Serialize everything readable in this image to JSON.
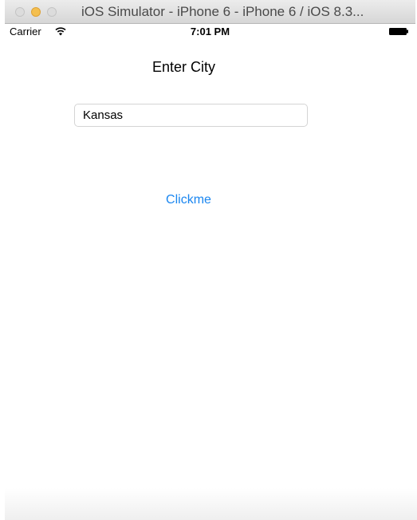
{
  "window": {
    "title": "iOS Simulator - iPhone 6 - iPhone 6 / iOS 8.3..."
  },
  "status_bar": {
    "carrier": "Carrier",
    "wifi_icon": "wifi-icon",
    "time": "7:01 PM",
    "battery_icon": "battery-icon"
  },
  "screen": {
    "heading": "Enter City",
    "city_input": {
      "value": "Kansas",
      "placeholder": ""
    },
    "submit_label": "Clickme"
  },
  "colors": {
    "accent": "#1a86f0",
    "minimize_button": "#f4bf4f",
    "titlebar": "#e0e0e0"
  }
}
